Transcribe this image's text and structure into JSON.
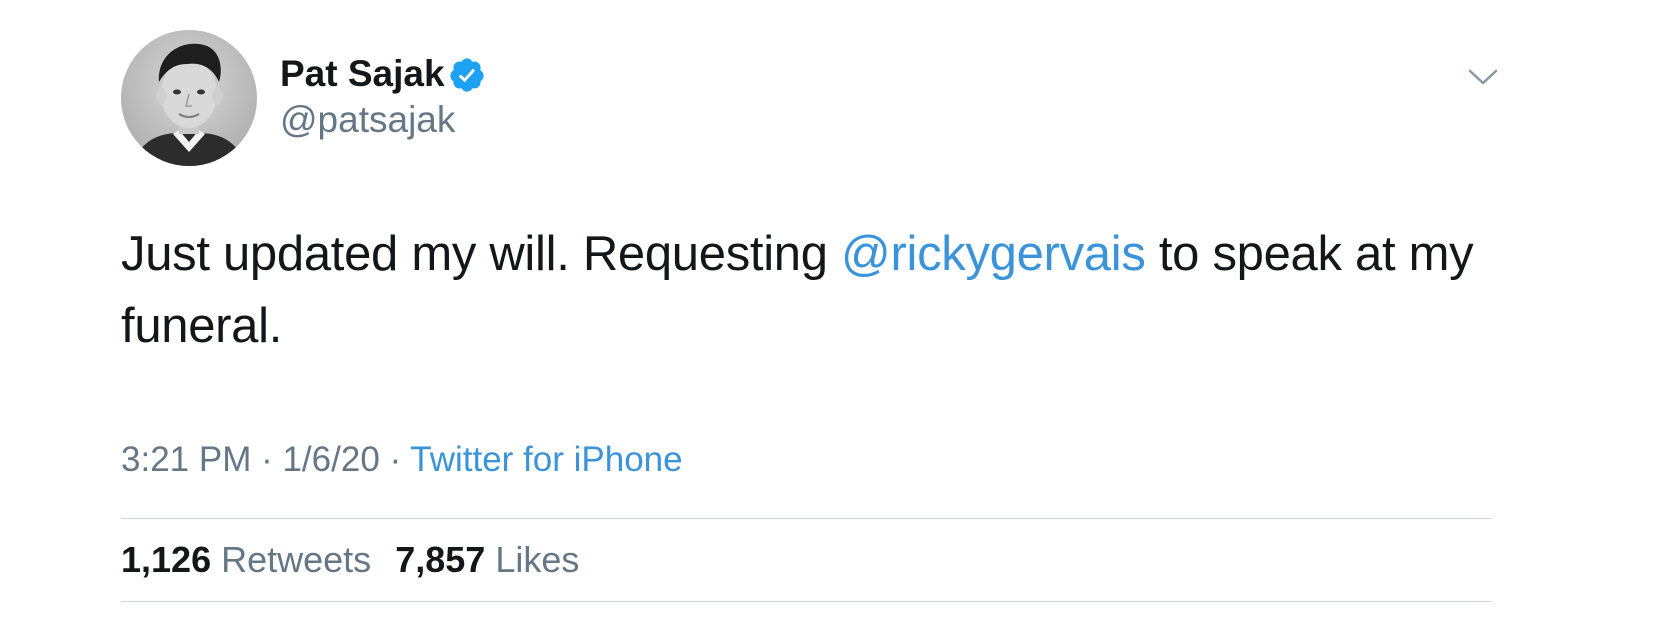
{
  "user": {
    "display_name": "Pat Sajak",
    "handle": "@patsajak",
    "verified": true,
    "verified_icon": "verified-badge-icon",
    "avatar": "profile-photo"
  },
  "tweet": {
    "text_before": "Just updated my will. Requesting ",
    "mention": "@rickygervais",
    "text_after": " to speak at my funeral."
  },
  "meta": {
    "time": "3:21 PM",
    "separator1": " · ",
    "date": "1/6/20",
    "separator2": " · ",
    "source": "Twitter for iPhone"
  },
  "stats": {
    "retweets_count": "1,126",
    "retweets_label": "Retweets",
    "likes_count": "7,857",
    "likes_label": "Likes"
  },
  "colors": {
    "link": "#3b94d9",
    "muted": "#657786",
    "text": "#14171a",
    "verified": "#1da1f2",
    "divider": "#cfd6db"
  }
}
